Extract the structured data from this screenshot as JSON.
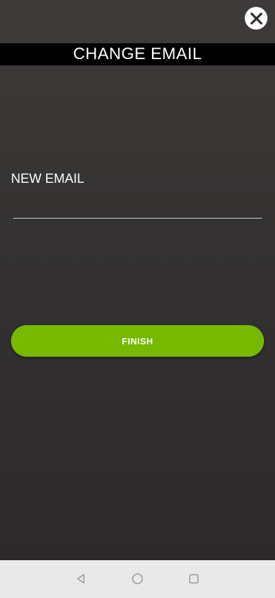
{
  "header": {
    "title": "CHANGE EMAIL",
    "close_icon": "close-icon"
  },
  "form": {
    "new_email_label": "NEW EMAIL",
    "email_value": "",
    "email_placeholder": "",
    "finish_label": "FINISH"
  },
  "system_nav": {
    "back_icon": "back-triangle-icon",
    "home_icon": "home-circle-icon",
    "recents_icon": "recents-square-icon"
  },
  "colors": {
    "accent": "#76b900",
    "title_bar": "#000000",
    "background_top": "#3e3a39",
    "background_bottom": "#2a2828",
    "nav_bar": "#e9e9e9"
  }
}
